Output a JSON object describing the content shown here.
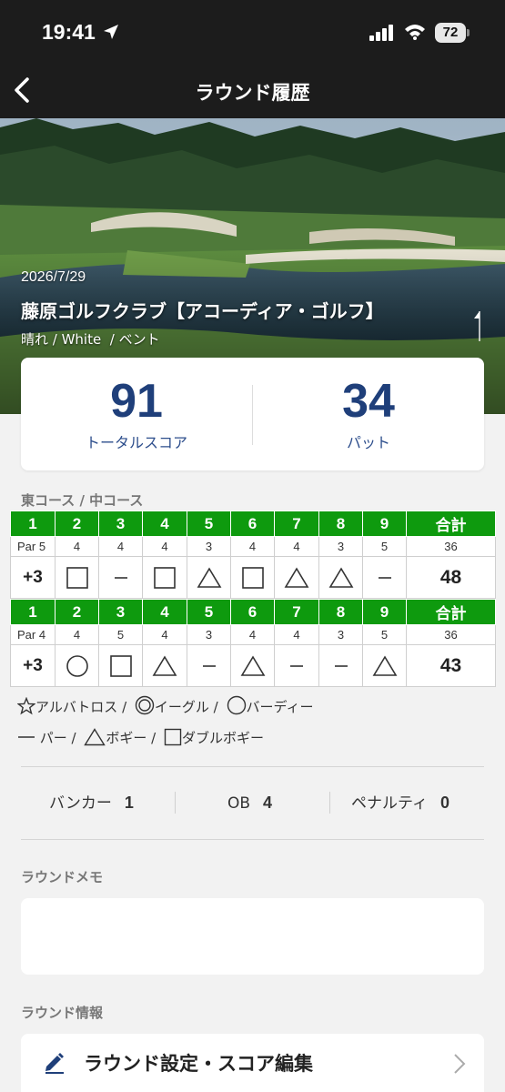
{
  "status_bar": {
    "time": "19:41",
    "battery": "72"
  },
  "nav": {
    "title": "ラウンド履歴"
  },
  "hero": {
    "date": "2026/7/29",
    "course_name": "藤原ゴルフクラブ【アコーディア・ゴルフ】",
    "conditions": "晴れ / White  / ベント"
  },
  "summary": {
    "total_score": "91",
    "total_label": "トータルスコア",
    "putts": "34",
    "putts_label": "パット"
  },
  "course_label": "東コース / 中コース",
  "front": {
    "header": [
      "1",
      "2",
      "3",
      "4",
      "5",
      "6",
      "7",
      "8",
      "9",
      "合計"
    ],
    "par_label": "Par 5",
    "pars": [
      "4",
      "4",
      "4",
      "3",
      "4",
      "4",
      "3",
      "5",
      "36"
    ],
    "over_par": "+3",
    "marks": [
      "square",
      "par",
      "square",
      "triangle",
      "square",
      "triangle",
      "triangle",
      "par"
    ],
    "total": "48"
  },
  "back": {
    "header": [
      "1",
      "2",
      "3",
      "4",
      "5",
      "6",
      "7",
      "8",
      "9",
      "合計"
    ],
    "par_label": "Par 4",
    "pars": [
      "4",
      "5",
      "4",
      "3",
      "4",
      "4",
      "3",
      "5",
      "36"
    ],
    "over_par": "+3",
    "marks": [
      "circle",
      "square",
      "triangle",
      "par",
      "triangle",
      "par",
      "par",
      "triangle"
    ],
    "total": "43"
  },
  "legend": {
    "albatross": "アルバトロス /",
    "eagle": "イーグル /",
    "birdie": "バーディー",
    "par": "パー /",
    "bogey": "ボギー /",
    "double_bogey": "ダブルボギー"
  },
  "stats": {
    "bunker_label": "バンカー",
    "bunker_value": "1",
    "ob_label": "OB",
    "ob_value": "4",
    "penalty_label": "ペナルティ",
    "penalty_value": "0"
  },
  "memo": {
    "label": "ラウンドメモ",
    "text": ""
  },
  "info": {
    "label": "ラウンド情報",
    "edit_label": "ラウンド設定・スコア編集"
  },
  "colors": {
    "header_green": "#0e9a0e",
    "score_blue": "#1f3f7a",
    "nav_bg": "#1c1c1c"
  },
  "icons": [
    "location-arrow-icon",
    "signal-icon",
    "wifi-icon",
    "battery-icon",
    "back-chevron-icon",
    "pencil-icon",
    "chevron-right-icon"
  ]
}
